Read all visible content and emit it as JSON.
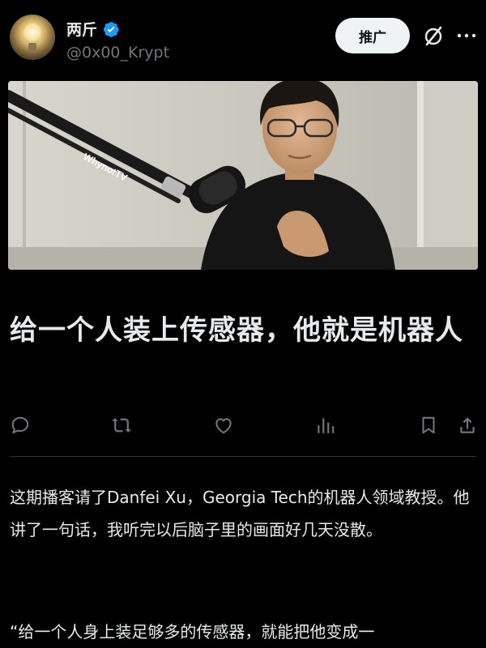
{
  "author": {
    "display_name": "两斤",
    "handle": "@0x00_Krypt",
    "verified": true
  },
  "header": {
    "promote_label": "推广"
  },
  "media": {
    "mic_brand": "WhynotTV"
  },
  "post": {
    "title": "给一个人装上传感器，他就是机器人",
    "paragraph_1": "这期播客请了Danfei Xu，Georgia Tech的机器人领域教授。他讲了一句话，我听完以后脑子里的画面好几天没散。",
    "paragraph_2": "“给一个人身上装足够多的传感器，就能把他变成一"
  },
  "actions": [
    "reply-icon",
    "repost-icon",
    "like-icon",
    "views-icon",
    "bookmark-icon",
    "share-icon"
  ],
  "colors": {
    "background": "#000000",
    "text": "#e7e9ea",
    "secondary": "#71767b",
    "verified": "#1d9bf0"
  }
}
